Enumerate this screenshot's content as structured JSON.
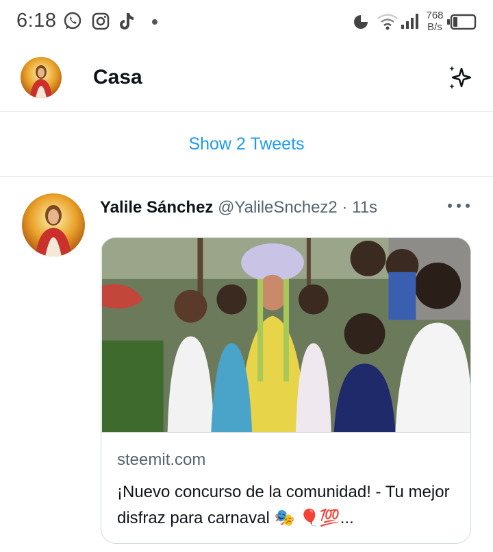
{
  "status_bar": {
    "time": "6:18",
    "net_speed_value": "768",
    "net_speed_unit": "B/s",
    "icons": [
      "whatsapp-icon",
      "instagram-icon",
      "tiktok-icon",
      "notification-dot",
      "data-saver-icon",
      "wifi-icon",
      "signal-icon",
      "battery-icon"
    ]
  },
  "header": {
    "title": "Casa",
    "icons": [
      "profile-avatar",
      "sparkle-icon"
    ]
  },
  "show_tweets": {
    "label": "Show 2 Tweets"
  },
  "tweet": {
    "name": "Yalile Sánchez",
    "handle": "@YalileSnchez2",
    "separator": "·",
    "time": "11s",
    "card": {
      "domain": "steemit.com",
      "title": "¡Nuevo concurso de la comunidad! - Tu mejor disfraz para carnaval 🎭 🎈💯..."
    }
  },
  "colors": {
    "accent": "#1d9bf0",
    "text_primary": "#0f1419",
    "text_secondary": "#536471",
    "divider": "#e6ecf0"
  }
}
